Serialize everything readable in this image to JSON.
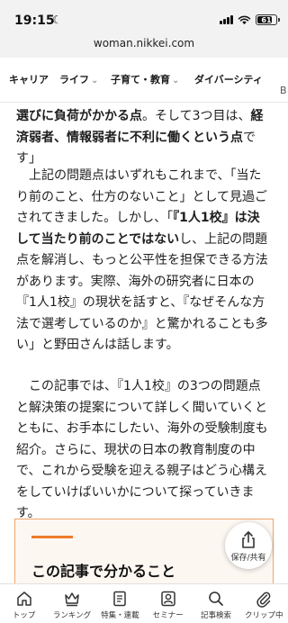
{
  "status_bar": {
    "time": "19:15",
    "battery_level": "61"
  },
  "url_bar": {
    "url": "woman.nikkei.com"
  },
  "nav": {
    "items": [
      {
        "label": "キャリア",
        "has_chevron": false
      },
      {
        "label": "ライフ",
        "has_chevron": true
      },
      {
        "label": "子育て・教育",
        "has_chevron": true
      },
      {
        "label": "ダイバーシティ",
        "has_chevron": false
      }
    ],
    "overflow_label": "B"
  },
  "article": {
    "p1": [
      {
        "text": "選びに負荷がかかる点",
        "bold": true
      },
      {
        "text": "。そして3つ目は、",
        "bold": false
      },
      {
        "text": "経済弱者、情報弱者に不利に働くという点",
        "bold": true
      },
      {
        "text": "です」",
        "bold": false
      }
    ],
    "p2": [
      {
        "text": "　上記の問題点はいずれもこれまで、「当たり前のこと、仕方のないこと」として見過ごされてきました。しかし、「",
        "bold": false
      },
      {
        "text": "『1人1校』は決して当たり前のことではない",
        "bold": true
      },
      {
        "text": "し、上記の問題点を解消し、もっと公平性を担保できる方法があります。実際、海外の研究者に日本の『1人1校』の現状を話すと、『なぜそんな方法で選考しているのか』と驚かれることも多い」と野田さんは話します。",
        "bold": false
      }
    ],
    "p3": [
      {
        "text": "　この記事では、『1人1校』の3つの問題点と解決策の提案について詳しく聞いていくとともに、お手本にしたい、海外の受験制度も紹介。さらに、現状の日本の教育制度の中で、これから受験を迎える親子はどう心構えをしていけばいいかについて探っていきます。",
        "bold": false
      }
    ]
  },
  "summary": {
    "title": "この記事で分かること",
    "accent_color": "#f07a2a"
  },
  "fab": {
    "label": "保存/共有"
  },
  "bottom_nav": {
    "tabs": [
      {
        "label": "トップ",
        "icon": "home-icon"
      },
      {
        "label": "ランキング",
        "icon": "crown-icon"
      },
      {
        "label": "特集・連載",
        "icon": "book-icon"
      },
      {
        "label": "セミナー",
        "icon": "person-icon"
      },
      {
        "label": "記事検索",
        "icon": "search-icon"
      },
      {
        "label": "クリップ中",
        "icon": "clip-icon"
      }
    ]
  }
}
